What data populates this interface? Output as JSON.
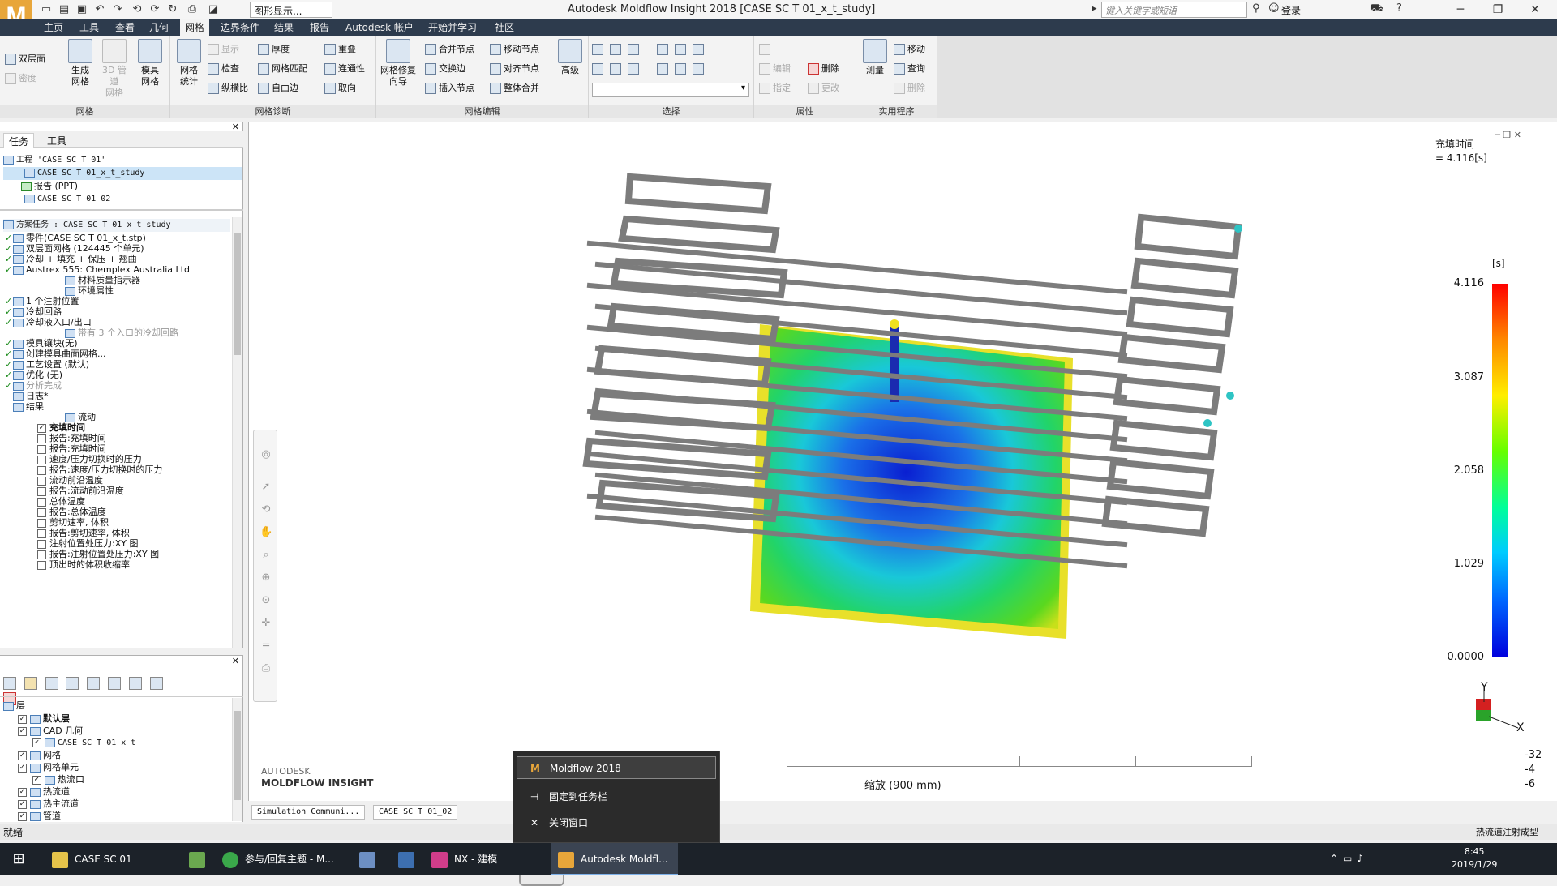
{
  "titlebar": {
    "app_logo": "M",
    "qa_combo": "图形显示...",
    "window_title": "Autodesk Moldflow Insight 2018     [CASE SC T 01_x_t_study]",
    "search_placeholder": "键入关键字或短语",
    "login": "登录"
  },
  "menu": [
    "主页",
    "工具",
    "查看",
    "几何",
    "网格",
    "边界条件",
    "结果",
    "报告",
    "Autodesk 帐户",
    "开始并学习",
    "社区"
  ],
  "ribbon": {
    "double_layer": "双层面",
    "density": "密度",
    "generate_mesh": "生成\n网格",
    "pipe_3d": "3D 管道\n网格",
    "mold_mesh": "模具\n网格",
    "mesh_stats": "网格\n统计",
    "show": "显示",
    "check": "检查",
    "thickness": "厚度",
    "mesh_match": "网格匹配",
    "aspect_ratio": "纵横比",
    "overlap": "重叠",
    "connectivity": "连通性",
    "free_edge": "自由边",
    "orientation": "取向",
    "repair_wizard": "网格修复\n向导",
    "merge_nodes": "合并节点",
    "swap_edges": "交换边",
    "insert_node": "插入节点",
    "move_node": "移动节点",
    "align_nodes": "对齐节点",
    "global_merge": "整体合并",
    "advanced": "高级",
    "edit": "编辑",
    "assign": "指定",
    "delete": "删除",
    "change": "更改",
    "measure": "测量",
    "move": "移动",
    "query": "查询",
    "util_delete": "删除",
    "groups": {
      "mesh": "网格",
      "diagnostics": "网格诊断",
      "editing": "网格编辑",
      "select": "选择",
      "properties": "属性",
      "utilities": "实用程序"
    }
  },
  "task_panel": {
    "tabs": [
      "任务",
      "工具"
    ],
    "project": [
      {
        "label": "工程 'CASE SC T 01'",
        "mono": true
      },
      {
        "label": "CASE SC T 01_x_t_study",
        "mono": true
      },
      {
        "label": "报告 (PPT)",
        "mono": false
      },
      {
        "label": "CASE SC T 01_02",
        "mono": true
      }
    ],
    "study_header": "方案任务 : CASE SC T 01_x_t_study",
    "tasks": [
      {
        "chk": "✓",
        "label": "零件(CASE SC T 01_x_t.stp)"
      },
      {
        "chk": "✓",
        "label": "双层面网格 (124445 个单元)"
      },
      {
        "chk": "✓",
        "label": "冷却 + 填充 + 保压 + 翘曲"
      },
      {
        "chk": "✓",
        "label": "Austrex 555: Chemplex Australia Ltd"
      },
      {
        "chk": "",
        "label": "材料质量指示器",
        "indent": true
      },
      {
        "chk": "",
        "label": "环境属性",
        "indent": true
      },
      {
        "chk": "✓",
        "label": "1 个注射位置"
      },
      {
        "chk": "✓",
        "label": "冷却回路"
      },
      {
        "chk": "✓",
        "label": "冷却液入口/出口"
      },
      {
        "chk": "",
        "label": "带有 3 个入口的冷却回路",
        "indent": true,
        "muted": true
      },
      {
        "chk": "✓",
        "label": "模具镶块(无)"
      },
      {
        "chk": "✓",
        "label": "创建模具曲面网格..."
      },
      {
        "chk": "✓",
        "label": "工艺设置 (默认)"
      },
      {
        "chk": "✓",
        "label": "优化 (无)"
      },
      {
        "chk": "✓",
        "label": "分析完成",
        "muted": true
      },
      {
        "chk": "",
        "label": "日志*"
      },
      {
        "chk": "",
        "label": "结果"
      },
      {
        "chk": "",
        "label": "流动",
        "indent": true
      }
    ],
    "results": [
      {
        "label": "充填时间",
        "checked": true,
        "bold": true
      },
      {
        "label": "报告:充填时间",
        "checked": false
      },
      {
        "label": "报告:充填时间",
        "checked": false
      },
      {
        "label": "速度/压力切换时的压力",
        "checked": false
      },
      {
        "label": "报告:速度/压力切换时的压力",
        "checked": false
      },
      {
        "label": "流动前沿温度",
        "checked": false
      },
      {
        "label": "报告:流动前沿温度",
        "checked": false
      },
      {
        "label": "总体温度",
        "checked": false
      },
      {
        "label": "报告:总体温度",
        "checked": false
      },
      {
        "label": "剪切速率, 体积",
        "checked": false
      },
      {
        "label": "报告:剪切速率, 体积",
        "checked": false
      },
      {
        "label": "注射位置处压力:XY 图",
        "checked": false
      },
      {
        "label": "报告:注射位置处压力:XY 图",
        "checked": false
      },
      {
        "label": "顶出时的体积收缩率",
        "checked": false
      }
    ]
  },
  "layer_panel": {
    "header": "层",
    "layers": [
      {
        "label": "默认层",
        "bold": true,
        "level": 1
      },
      {
        "label": "CAD 几何",
        "level": 1
      },
      {
        "label": "CASE SC T 01_x_t",
        "level": 2,
        "mono": true
      },
      {
        "label": "网格",
        "level": 1
      },
      {
        "label": "网格单元",
        "level": 1
      },
      {
        "label": "热流口",
        "level": 2
      },
      {
        "label": "热流道",
        "level": 1
      },
      {
        "label": "热主流道",
        "level": 1
      },
      {
        "label": "管道",
        "level": 1
      }
    ]
  },
  "viewport": {
    "result_title": "充填时间",
    "result_value": "= 4.116[s]",
    "legend_unit": "[s]",
    "legend_ticks": [
      "4.116",
      "3.087",
      "2.058",
      "1.029",
      "0.0000"
    ],
    "scale_label": "缩放 (900 mm)",
    "triad": {
      "y": "Y",
      "x": "X"
    },
    "coords": [
      "-32",
      "-4",
      "-6"
    ],
    "brand_small": "AUTODESK",
    "brand_main": "MOLDFLOW INSIGHT"
  },
  "doc_tabs": [
    "Simulation Communi...",
    "CASE SC T 01_02"
  ],
  "status": {
    "left": "就绪",
    "right": "热流道注射成型"
  },
  "context_menu": {
    "items": [
      "Moldflow 2018",
      "固定到任务栏",
      "关闭窗口"
    ]
  },
  "taskbar": {
    "items": [
      "CASE SC 01",
      "参与/回复主题 - M...",
      "NX - 建模",
      "Autodesk Moldfl..."
    ],
    "time": "8:45",
    "date": "2019/1/29"
  },
  "colors": {
    "menubar": "#2d3b4d",
    "accent": "#e8a63a"
  }
}
